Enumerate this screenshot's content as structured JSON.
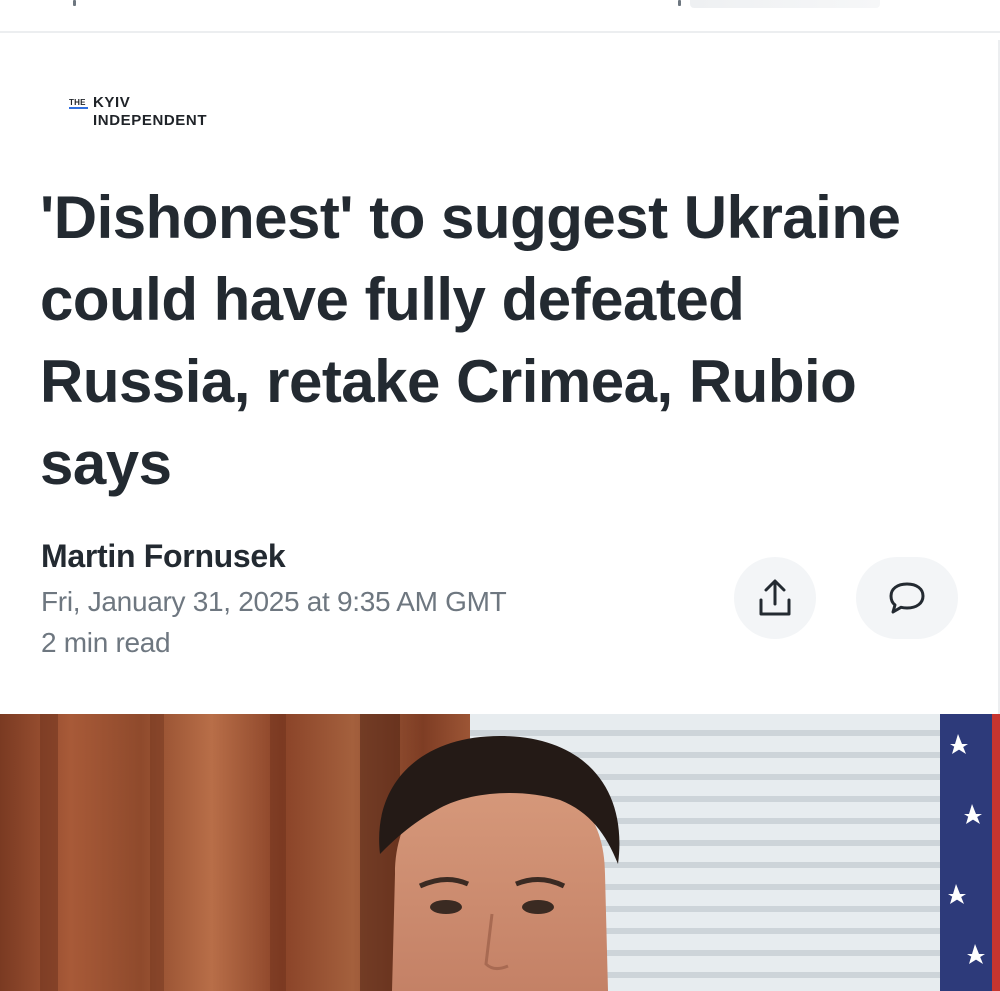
{
  "publisher": {
    "logo_the": "THE",
    "logo_line1": "KYIV",
    "logo_line2": "INDEPENDENT"
  },
  "article": {
    "headline": "'Dishonest' to suggest Ukraine could have fully defeated Russia, retake Crimea, Rubio says",
    "author": "Martin Fornusek",
    "date": "Fri, January 31, 2025 at 9:35 AM GMT",
    "read_time": "2 min read"
  },
  "actions": {
    "share_icon": "share-icon",
    "comment_icon": "comment-icon"
  },
  "colors": {
    "text_primary": "#232a31",
    "text_secondary": "#6e7780",
    "button_bg": "#f3f5f7",
    "logo_accent": "#2f6fe0"
  }
}
